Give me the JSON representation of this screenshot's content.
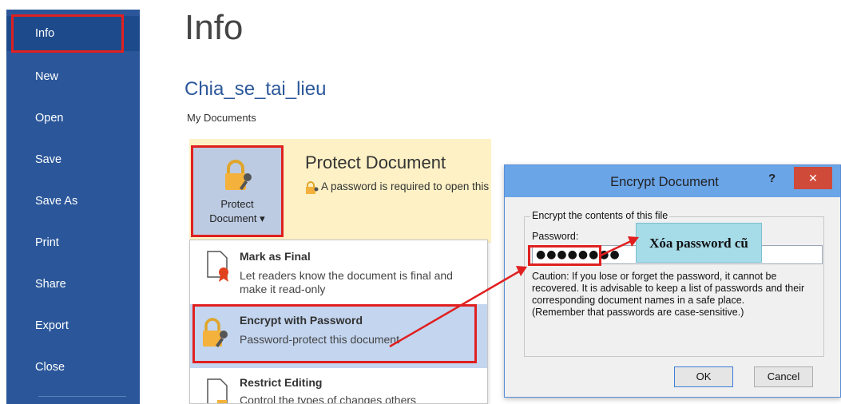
{
  "sidebar": {
    "items": [
      {
        "label": "Info"
      },
      {
        "label": "New"
      },
      {
        "label": "Open"
      },
      {
        "label": "Save"
      },
      {
        "label": "Save As"
      },
      {
        "label": "Print"
      },
      {
        "label": "Share"
      },
      {
        "label": "Export"
      },
      {
        "label": "Close"
      }
    ]
  },
  "main": {
    "title": "Info",
    "doc_name": "Chia_se_tai_lieu",
    "doc_path": "My Documents"
  },
  "protect": {
    "tile_label_1": "Protect",
    "tile_label_2": "Document ▾",
    "title": "Protect Document",
    "description": "A password is required to open this document."
  },
  "menu": {
    "items": [
      {
        "title": "Mark as Final",
        "description": "Let readers know the document is final and make it read-only"
      },
      {
        "title": "Encrypt with Password",
        "description": "Password-protect this document"
      },
      {
        "title": "Restrict Editing",
        "description": "Control the types of changes others"
      }
    ]
  },
  "dialog": {
    "title": "Encrypt Document",
    "help": "?",
    "close": "✕",
    "group_label": "Encrypt the contents of this file",
    "password_label": "Password:",
    "password_value": "●●●●●●●●",
    "caution": "Caution: If you lose or forget the password, it cannot be recovered. It is advisable to keep a list of passwords and their corresponding document names in a safe place.",
    "remember": "(Remember that passwords are case-sensitive.)",
    "ok": "OK",
    "cancel": "Cancel"
  },
  "annotation": {
    "callout": "Xóa password cũ"
  },
  "colors": {
    "sidebar": "#2b579a",
    "accent_red": "#e02020",
    "highlight": "#c3d5ef",
    "protect_panel": "#fdf1c5"
  }
}
